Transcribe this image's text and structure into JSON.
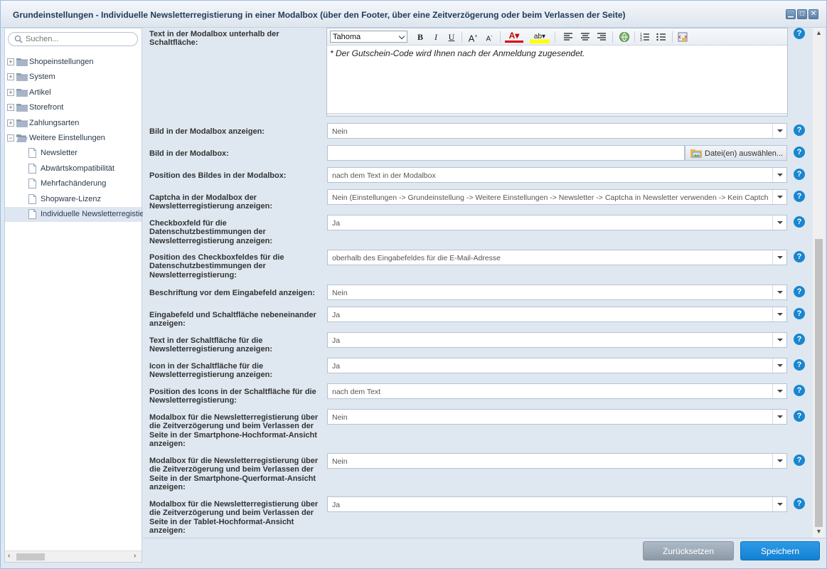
{
  "window": {
    "title": "Grundeinstellungen - Individuelle Newsletterregistierung in einer Modalbox (über den Footer, über eine Zeitverzögerung oder beim Verlassen der Seite)"
  },
  "sidebar": {
    "search_placeholder": "Suchen...",
    "items": [
      {
        "label": "Shopeinstellungen",
        "type": "folder",
        "expanded": false
      },
      {
        "label": "System",
        "type": "folder",
        "expanded": false
      },
      {
        "label": "Artikel",
        "type": "folder",
        "expanded": false
      },
      {
        "label": "Storefront",
        "type": "folder",
        "expanded": false
      },
      {
        "label": "Zahlungsarten",
        "type": "folder",
        "expanded": false
      },
      {
        "label": "Weitere Einstellungen",
        "type": "folder",
        "expanded": true
      },
      {
        "label": "Newsletter",
        "type": "file"
      },
      {
        "label": "Abwärtskompatibilität",
        "type": "file"
      },
      {
        "label": "Mehrfachänderung",
        "type": "file"
      },
      {
        "label": "Shopware-Lizenz",
        "type": "file"
      },
      {
        "label": "Individuelle Newsletterregistierung",
        "type": "file",
        "selected": true
      }
    ]
  },
  "editor": {
    "label": "Text in der Modalbox unterhalb der Schaltfläche:",
    "font": "Tahoma",
    "text": "* Der Gutschein-Code wird Ihnen nach der Anmeldung zugesendet."
  },
  "fields": {
    "show_image": {
      "label": "Bild in der Modalbox anzeigen:",
      "value": "Nein"
    },
    "image": {
      "label": "Bild in der Modalbox:",
      "value": "",
      "button": "Datei(en) auswählen..."
    },
    "image_position": {
      "label": "Position des Bildes in der Modalbox:",
      "value": "nach dem Text in der Modalbox"
    },
    "captcha": {
      "label": "Captcha in der Modalbox der Newsletterregistierung anzeigen:",
      "value": "Nein (Einstellungen -> Grundeinstellung -> Weitere Einstellungen -> Newsletter -> Captcha in Newsletter verwenden -> Kein Captcha)"
    },
    "privacy_checkbox": {
      "label": "Checkboxfeld für die Datenschutzbestimmungen der Newsletterregistierung anzeigen:",
      "value": "Ja"
    },
    "privacy_position": {
      "label": "Position des Checkboxfeldes für die Datenschutzbestimmungen der Newsletterregistierung:",
      "value": "oberhalb des Eingabefeldes für die E-Mail-Adresse"
    },
    "input_caption": {
      "label": "Beschriftung vor dem Eingabefeld anzeigen:",
      "value": "Nein"
    },
    "side_by_side": {
      "label": "Eingabefeld und Schaltfläche nebeneinander anzeigen:",
      "value": "Ja"
    },
    "button_text": {
      "label": "Text in der Schaltfläche für die Newsletterregistierung anzeigen:",
      "value": "Ja"
    },
    "button_icon": {
      "label": "Icon in der Schaltfläche für die Newsletterregistierung anzeigen:",
      "value": "Ja"
    },
    "icon_position": {
      "label": "Position des Icons in der Schaltfläche für die Newsletterregistierung:",
      "value": "nach dem Text"
    },
    "smartphone_portrait": {
      "label": "Modalbox für die Newsletterregistierung über die Zeitverzögerung und beim Verlassen der Seite in der Smartphone-Hochformat-Ansicht anzeigen:",
      "value": "Nein"
    },
    "smartphone_landscape": {
      "label": "Modalbox für die Newsletterregistierung über die Zeitverzögerung und beim Verlassen der Seite in der Smartphone-Querformat-Ansicht anzeigen:",
      "value": "Nein"
    },
    "tablet_portrait": {
      "label": "Modalbox für die Newsletterregistierung über die Zeitverzögerung und beim Verlassen der Seite in der Tablet-Hochformat-Ansicht anzeigen:",
      "value": "Ja"
    }
  },
  "footer": {
    "reset_label": "Zurücksetzen",
    "save_label": "Speichern"
  },
  "colors": {
    "accent": "#1a86cf",
    "save": "#1a8ad9",
    "reset": "#9aa7b4"
  }
}
